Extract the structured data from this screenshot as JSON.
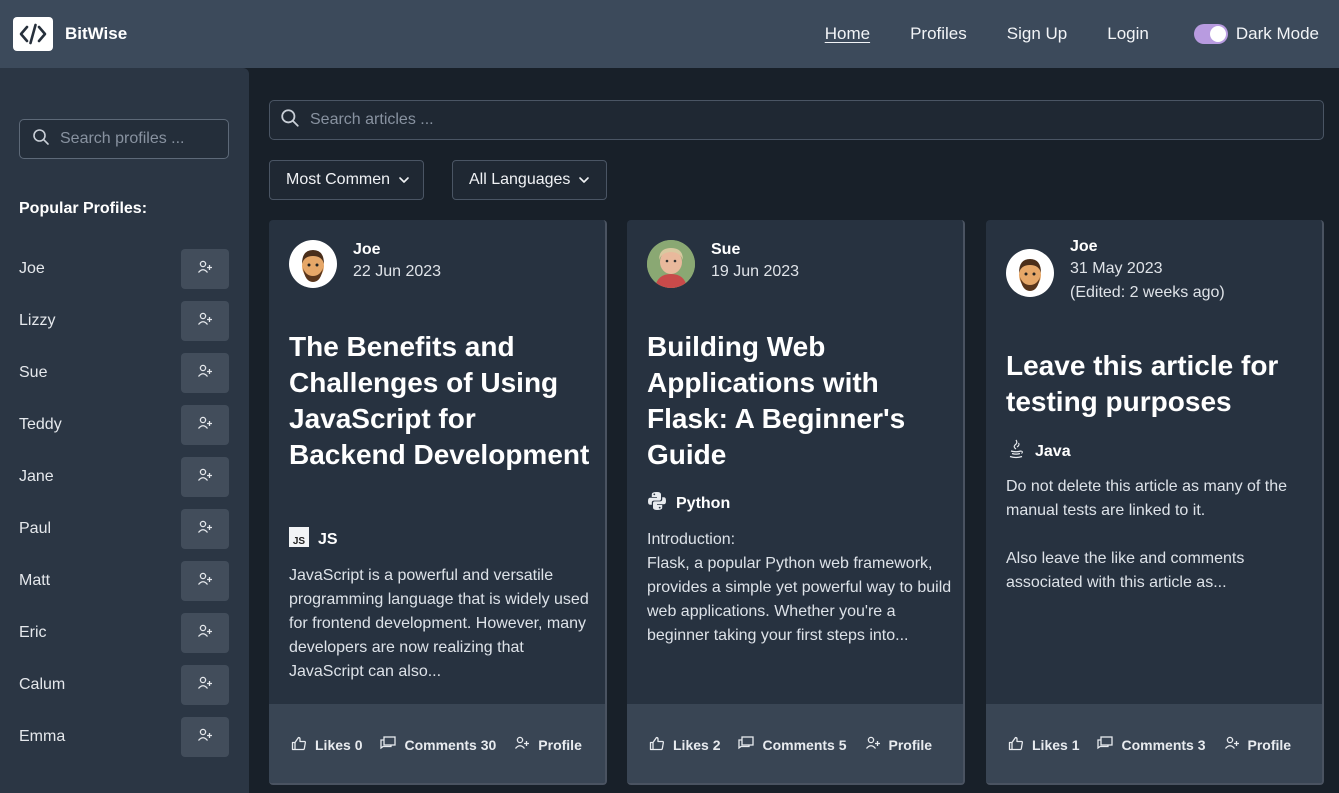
{
  "navbar": {
    "brand": "BitWise",
    "links": [
      {
        "label": "Home",
        "active": true
      },
      {
        "label": "Profiles"
      },
      {
        "label": "Sign Up"
      },
      {
        "label": "Login"
      }
    ],
    "dark_mode_label": "Dark Mode",
    "dark_mode_on": true,
    "toggle_color": "#b89be0"
  },
  "sidebar": {
    "search_placeholder": "Search profiles ...",
    "heading": "Popular Profiles:",
    "profiles": [
      "Joe",
      "Lizzy",
      "Sue",
      "Teddy",
      "Jane",
      "Paul",
      "Matt",
      "Eric",
      "Calum",
      "Emma"
    ]
  },
  "main": {
    "search_placeholder": "Search articles ...",
    "sort_dropdown": "Most Commen",
    "language_dropdown": "All Languages",
    "articles": [
      {
        "author": "Joe",
        "date": "22 Jun 2023",
        "edited": "",
        "title": "The Benefits and Challenges of Using JavaScript for Backend Development",
        "language": "JS",
        "language_icon": "js-icon",
        "excerpt": "JavaScript is a powerful and versatile programming language that is widely used for frontend development. However, many developers are now realizing that JavaScript can also...",
        "likes": "Likes 0",
        "comments": "Comments 30",
        "profile": "Profile"
      },
      {
        "author": "Sue",
        "date": "19 Jun 2023",
        "edited": "",
        "title": "Building Web Applications with Flask: A Beginner's Guide",
        "language": "Python",
        "language_icon": "python-icon",
        "excerpt": "Introduction:\nFlask, a popular Python web framework, provides a simple yet powerful way to build web applications. Whether you're a beginner taking your first steps into...",
        "likes": "Likes 2",
        "comments": "Comments 5",
        "profile": "Profile"
      },
      {
        "author": "Joe",
        "date": "31 May 2023",
        "edited": "(Edited: 2 weeks ago)",
        "title": "Leave this article for testing purposes",
        "language": "Java",
        "language_icon": "java-icon",
        "excerpt": "Do not delete this article as many of the manual tests are linked to it.\n\nAlso leave the like and comments associated with this article as...",
        "likes": "Likes 1",
        "comments": "Comments 3",
        "profile": "Profile"
      }
    ]
  }
}
